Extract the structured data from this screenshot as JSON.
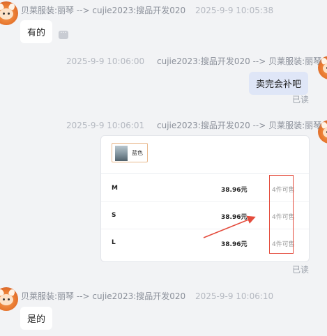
{
  "messages": [
    {
      "sender": "贝莱服装:丽琴",
      "arrow": "-->",
      "receiver": "cujie2023:搜品开发020",
      "time": "2025-9-9 10:05:38",
      "text": "有的",
      "more_icon": "ellipsis-icon"
    },
    {
      "sender": "cujie2023:搜品开发020",
      "arrow": "-->",
      "receiver": "贝莱服装:丽琴",
      "time": "2025-9-9 10:06:00",
      "text": "卖完会补吧",
      "status": "已读"
    },
    {
      "sender": "cujie2023:搜品开发020",
      "arrow": "-->",
      "receiver": "贝莱服装:丽琴",
      "time": "2025-9-9 10:06:01",
      "status": "已读"
    },
    {
      "sender": "贝莱服装:丽琴",
      "arrow": "-->",
      "receiver": "cujie2023:搜品开发020",
      "time": "2025-9-9 10:06:10",
      "text": "是的"
    }
  ],
  "product_card": {
    "thumb_label": "蓝色",
    "rows": [
      {
        "size": "M",
        "price": "38.96元",
        "stock": "4件可售"
      },
      {
        "size": "S",
        "price": "38.96元",
        "stock": "4件可售"
      },
      {
        "size": "L",
        "price": "38.96元",
        "stock": "4件可售"
      }
    ]
  },
  "annotation": {
    "box_color": "#e44b3c",
    "arrow_color": "#e44b3c"
  }
}
